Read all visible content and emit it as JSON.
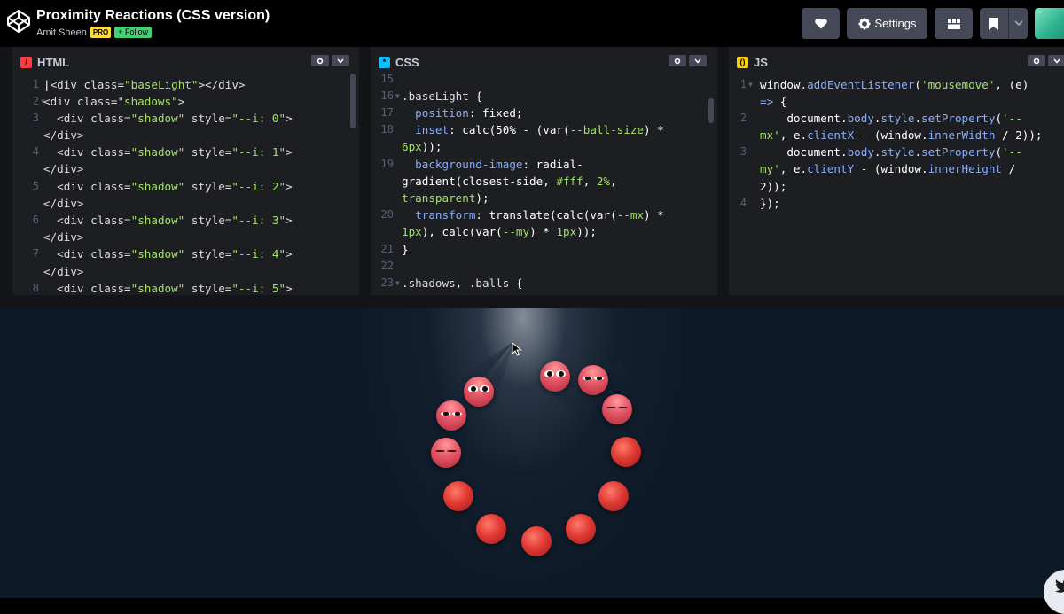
{
  "header": {
    "title": "Proximity Reactions (CSS version)",
    "author": "Amit Sheen",
    "pro_badge": "PRO",
    "follow_label": "+ Follow",
    "settings_label": "Settings"
  },
  "panels": {
    "html": {
      "label": "HTML",
      "icon": "html-icon",
      "color": "#ff3c41"
    },
    "css": {
      "label": "CSS",
      "icon": "css-icon",
      "color": "#0ebeff"
    },
    "js": {
      "label": "JS",
      "icon": "js-icon",
      "color": "#fcd000"
    }
  },
  "html_code": {
    "line_numbers": [
      "1",
      "2",
      "3",
      "",
      "4",
      "",
      "5",
      "",
      "6",
      "",
      "7",
      "",
      "8"
    ]
  },
  "css_code": {
    "line_numbers": [
      "15",
      "16",
      "17",
      "18",
      "",
      "19",
      "",
      "",
      "20",
      "",
      "21",
      "22",
      "23"
    ]
  },
  "js_code": {
    "line_numbers": [
      "1",
      "",
      "2",
      "",
      "3",
      "",
      "4"
    ]
  },
  "colors": {
    "accent_pro": "#ffdd40",
    "accent_follow": "#47cf73",
    "editor_bg": "#1d1e22",
    "preview_bg": "#0e1a28"
  }
}
